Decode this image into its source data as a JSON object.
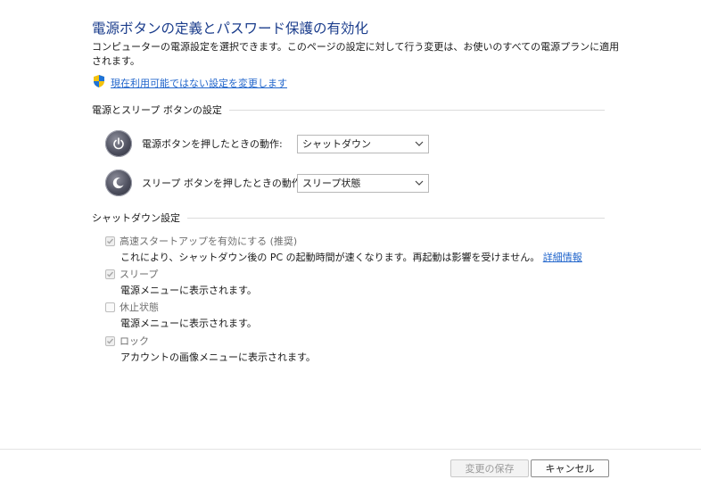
{
  "header": {
    "title": "電源ボタンの定義とパスワード保護の有効化",
    "description": "コンピューターの電源設定を選択できます。このページの設定に対して行う変更は、お使いのすべての電源プランに適用されます。",
    "change_link": "現在利用可能ではない設定を変更します"
  },
  "power_section": {
    "heading": "電源とスリープ ボタンの設定",
    "rows": [
      {
        "label": "電源ボタンを押したときの動作:",
        "value": "シャットダウン",
        "icon": "power-icon"
      },
      {
        "label": "スリープ ボタンを押したときの動作:",
        "value": "スリープ状態",
        "icon": "sleep-icon"
      }
    ]
  },
  "shutdown_section": {
    "heading": "シャットダウン設定",
    "options": [
      {
        "label": "高速スタートアップを有効にする (推奨)",
        "desc": "これにより、シャットダウン後の PC の起動時間が速くなります。再起動は影響を受けません。",
        "more": "詳細情報",
        "checked": true
      },
      {
        "label": "スリープ",
        "desc": "電源メニューに表示されます。",
        "checked": true
      },
      {
        "label": "休止状態",
        "desc": "電源メニューに表示されます。",
        "checked": false
      },
      {
        "label": "ロック",
        "desc": "アカウントの画像メニューに表示されます。",
        "checked": true
      }
    ]
  },
  "footer": {
    "save_label": "変更の保存",
    "cancel_label": "キャンセル"
  },
  "colors": {
    "title": "#1b3d8c",
    "link": "#2266cc"
  }
}
